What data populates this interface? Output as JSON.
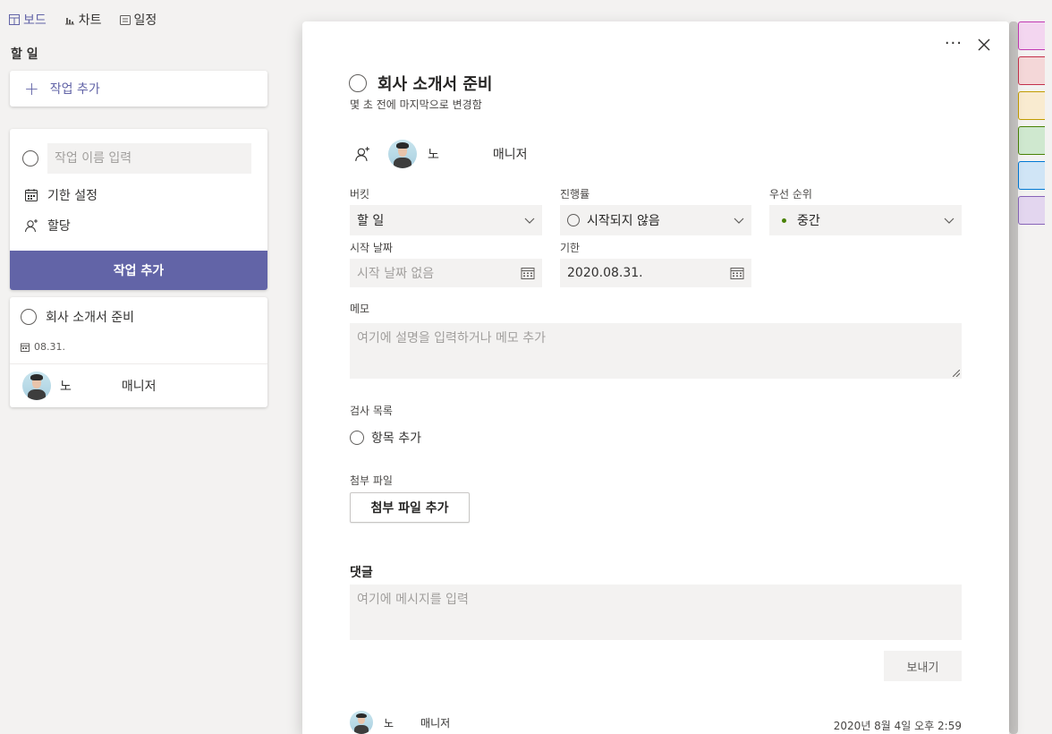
{
  "nav": {
    "items": [
      {
        "label": "보드",
        "icon": "board-icon",
        "active": true
      },
      {
        "label": "차트",
        "icon": "chart-icon",
        "active": false
      },
      {
        "label": "일정",
        "icon": "schedule-icon",
        "active": false
      }
    ]
  },
  "board": {
    "bucket_title": "할 일",
    "add_task_label": "작업 추가",
    "new_task": {
      "name_placeholder": "작업 이름 입력",
      "due_label": "기한 설정",
      "assign_label": "할당",
      "submit_label": "작업 추가"
    },
    "task_card": {
      "title": "회사 소개서 준비",
      "due": "08.31.",
      "assignee_first": "노",
      "assignee_last": "매니저"
    }
  },
  "modal": {
    "more_label": "···",
    "title": "회사 소개서 준비",
    "subtitle": "몇 초 전에 마지막으로 변경함",
    "assignee_first": "노",
    "assignee_last": "매니저",
    "bucket": {
      "label": "버킷",
      "value": "할 일"
    },
    "progress": {
      "label": "진행률",
      "value": "시작되지 않음"
    },
    "priority": {
      "label": "우선 순위",
      "value": "중간",
      "color": "#498205"
    },
    "start_date": {
      "label": "시작 날짜",
      "placeholder": "시작 날짜 없음"
    },
    "due_date": {
      "label": "기한",
      "value": "2020.08.31."
    },
    "memo": {
      "label": "메모",
      "placeholder": "여기에 설명을 입력하거나 메모 추가"
    },
    "checklist": {
      "label": "검사 목록",
      "add_label": "항목 추가"
    },
    "attachments": {
      "label": "첨부 파일",
      "add_label": "첨부 파일 추가"
    },
    "comments": {
      "title": "댓글",
      "placeholder": "여기에 메시지를 입력",
      "send_label": "보내기",
      "item": {
        "name_first": "노",
        "name_last": "매니저",
        "time": "2020년 8월 4일 오후 2:59"
      }
    }
  },
  "colors": {
    "accent": "#6264a7",
    "strips": [
      {
        "bg": "#f3d6f0",
        "border": "#c239b3"
      },
      {
        "bg": "#f4d7d8",
        "border": "#c4314b"
      },
      {
        "bg": "#f9ebd0",
        "border": "#c19c00"
      },
      {
        "bg": "#cfe8cf",
        "border": "#498205"
      },
      {
        "bg": "#d0e5f6",
        "border": "#0078d4"
      },
      {
        "bg": "#e3d6ef",
        "border": "#8764b8"
      }
    ]
  }
}
